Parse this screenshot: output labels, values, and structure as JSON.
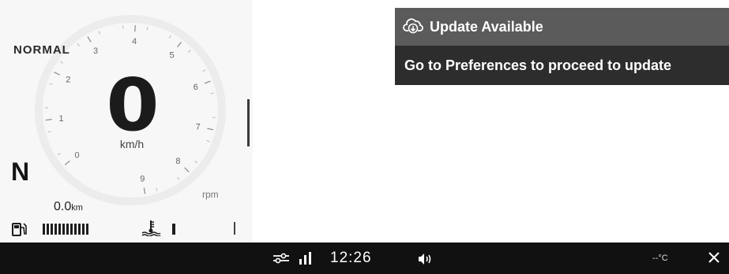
{
  "cluster": {
    "mode": "NORMAL",
    "speed": "0",
    "speed_unit": "km/h",
    "gear": "N",
    "rpm_unit": "rpm",
    "rpm_scale_labels": [
      "0",
      "1",
      "2",
      "3",
      "4",
      "5",
      "6",
      "7",
      "8",
      "9"
    ],
    "odometer_value": "0.0",
    "odometer_unit": "km",
    "fuel_level_fraction": 1.0,
    "fuel_segments": 12,
    "temp_level_segments": 1
  },
  "notification": {
    "title": "Update Available",
    "message": "Go to Preferences to proceed to update",
    "icon": "cloud-download-icon"
  },
  "status_bar": {
    "time": "12:26",
    "temperature": "--°C",
    "icons": [
      "settings-sliders-icon",
      "signal-icon",
      "volume-icon",
      "close-icon"
    ]
  },
  "colors": {
    "notification_header": "#5b5b5b",
    "notification_body": "#2d2d2d",
    "status_bar": "#111111",
    "dash_background": "#f7f7f7"
  }
}
